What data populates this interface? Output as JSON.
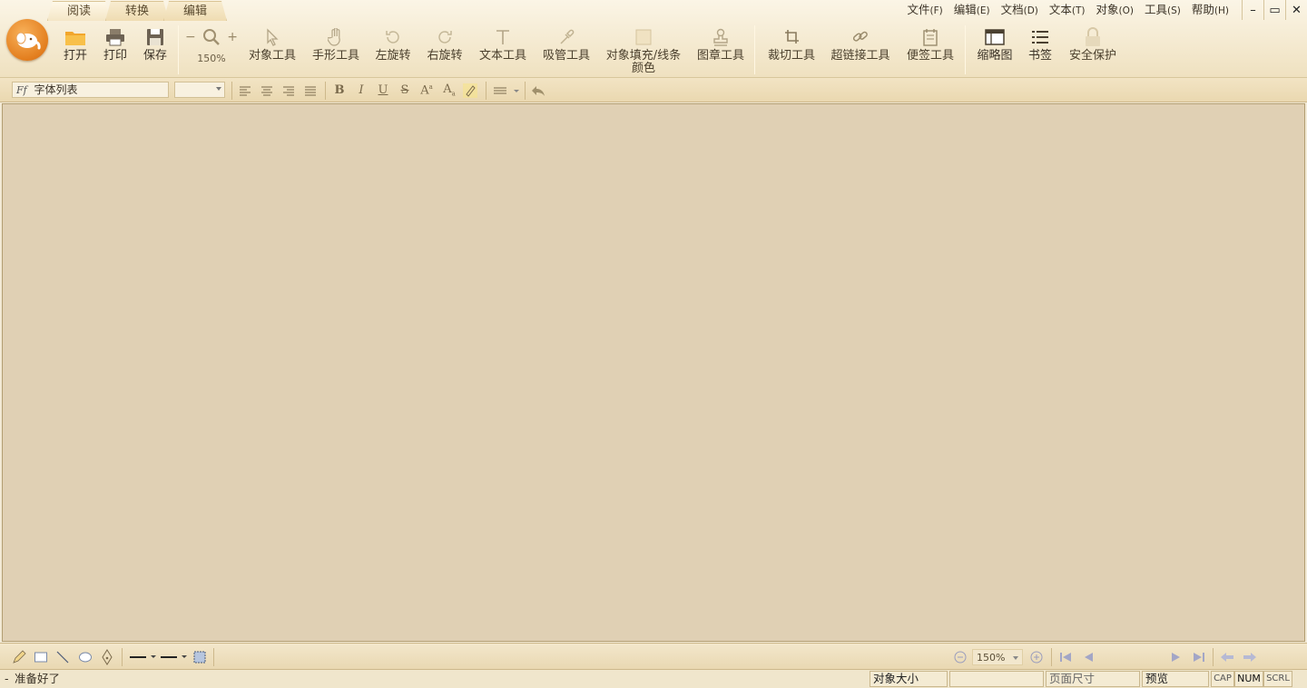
{
  "tabs": [
    {
      "label": "阅读",
      "active": true
    },
    {
      "label": "转换",
      "active": false
    },
    {
      "label": "编辑",
      "active": false
    }
  ],
  "menu": [
    {
      "label": "文件",
      "accel": "(F)"
    },
    {
      "label": "编辑",
      "accel": "(E)"
    },
    {
      "label": "文档",
      "accel": "(D)"
    },
    {
      "label": "文本",
      "accel": "(T)"
    },
    {
      "label": "对象",
      "accel": "(O)"
    },
    {
      "label": "工具",
      "accel": "(S)"
    },
    {
      "label": "帮助",
      "accel": "(H)"
    }
  ],
  "window": {
    "minimize": "–",
    "maximize": "▭",
    "close": "✕"
  },
  "ribbon": {
    "open": "打开",
    "print": "打印",
    "save": "保存",
    "zoom_value": "150%",
    "object_tool": "对象工具",
    "hand_tool": "手形工具",
    "rotate_left": "左旋转",
    "rotate_right": "右旋转",
    "text_tool": "文本工具",
    "eyedropper_tool": "吸管工具",
    "fill_color_line1": "对象填充/线条",
    "fill_color_line2": "颜色",
    "stamp_tool": "图章工具",
    "crop_tool": "裁切工具",
    "hyperlink_tool": "超链接工具",
    "note_tool": "便签工具",
    "thumbnails": "缩略图",
    "bookmarks": "书签",
    "security": "安全保护"
  },
  "format": {
    "font_list_placeholder": "字体列表",
    "font_size": ""
  },
  "bottom": {
    "zoom_value": "150%"
  },
  "status": {
    "dash": "-",
    "ready": "准备好了",
    "object_size": "对象大小",
    "page_size": "页面尺寸",
    "preview": "预览",
    "cap": "CAP",
    "num": "NUM",
    "scrl": "SCRL"
  },
  "colors": {
    "accent": "#e37e1e",
    "canvas": "#e0d0b4",
    "chrome": "#f4e9cf"
  }
}
